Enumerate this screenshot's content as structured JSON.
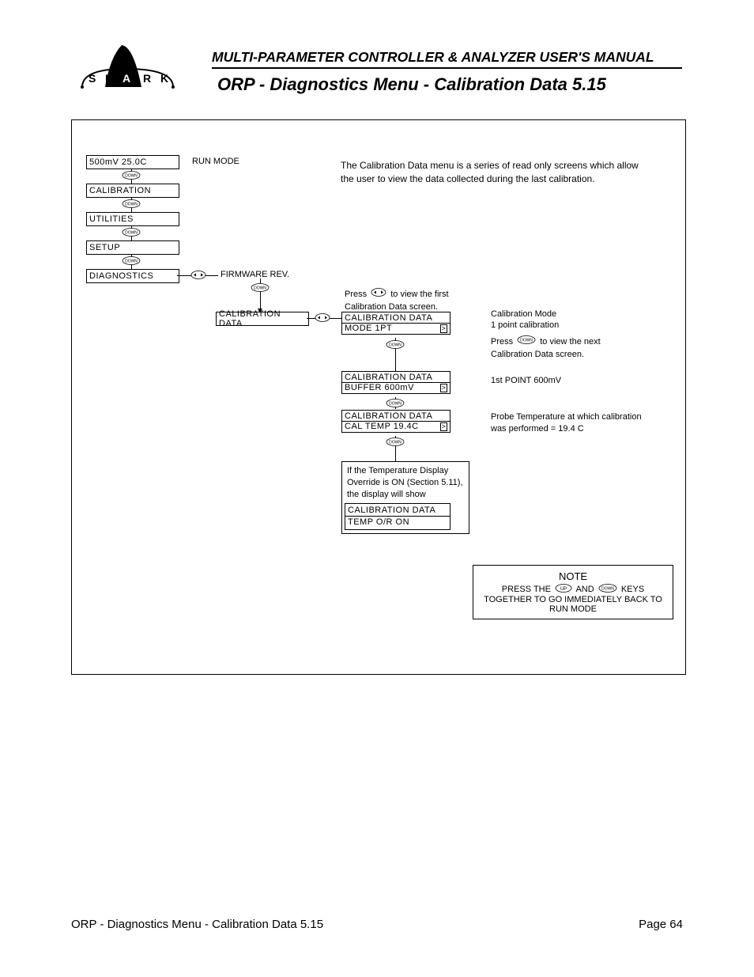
{
  "header": {
    "manual": "MULTI-PARAMETER CONTROLLER & ANALYZER USER'S MANUAL",
    "title": "ORP - Diagnostics Menu - Calibration Data 5.15",
    "logo": {
      "letters": "SHARK"
    }
  },
  "intro": "The Calibration Data menu is a series of read only screens which allow the user to view the data collected during the last calibration.",
  "menu": {
    "top": {
      "line": "500mV  25.0C",
      "label": "RUN MODE"
    },
    "items": [
      "CALIBRATION",
      "UTILITIES",
      "SETUP",
      "DIAGNOSTICS"
    ],
    "firmware": "FIRMWARE REV.",
    "caldata": "CALIBRATION DATA"
  },
  "screens": {
    "press_lr": "Press",
    "press_lr_after": "to view the first Calibration Data screen.",
    "mode": {
      "l1": "CALIBRATION DATA",
      "l2": "MODE  1PT"
    },
    "mode_right_a": "Calibration Mode",
    "mode_right_b": "1 point calibration",
    "press_down": "Press",
    "press_down_after": "to view the next Calibration Data screen.",
    "buffer": {
      "l1": "CALIBRATION DATA",
      "l2": "BUFFER   600mV"
    },
    "buffer_right": "1st POINT   600mV",
    "caltemp": {
      "l1": "CALIBRATION DATA",
      "l2": "CAL  TEMP  19.4C"
    },
    "caltemp_right": "Probe Temperature at which calibration was performed = 19.4 C",
    "override_text": "If the Temperature Display Override is ON (Section 5.11), the display will show",
    "override": {
      "l1": "CALIBRATION DATA",
      "l2": "TEMP O/R ON"
    }
  },
  "note": {
    "title": "NOTE",
    "before": "PRESS THE",
    "mid": "AND",
    "after": "KEYS TOGETHER TO GO IMMEDIATELY BACK TO RUN MODE"
  },
  "buttons": {
    "down": "DOWN",
    "up": "UP"
  },
  "footer": {
    "left": "ORP - Diagnostics Menu - Calibration Data 5.15",
    "right": "Page 64"
  }
}
